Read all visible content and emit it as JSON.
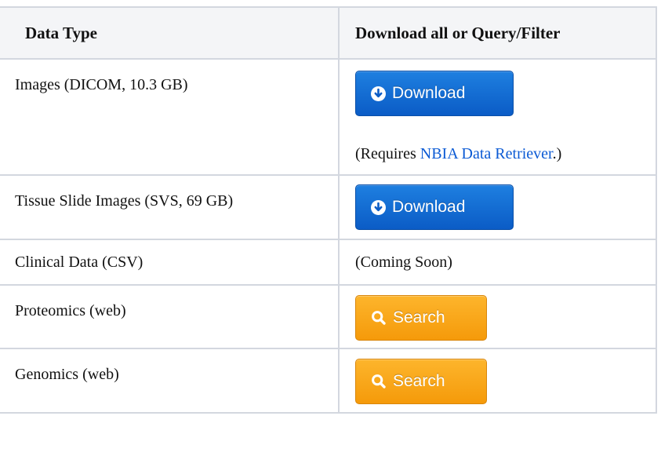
{
  "table": {
    "headers": [
      "Data Type",
      "Download all or Query/Filter"
    ],
    "rows": [
      {
        "data_type": "Images (DICOM, 10.3 GB)",
        "action_label": "Download",
        "action_kind": "download",
        "note_prefix": "(Requires ",
        "note_link": "NBIA Data Retriever",
        "note_suffix": ".)"
      },
      {
        "data_type": "Tissue Slide Images (SVS, 69 GB)",
        "action_label": "Download",
        "action_kind": "download"
      },
      {
        "data_type": "Clinical Data (CSV)",
        "action_text": "(Coming Soon)"
      },
      {
        "data_type": "Proteomics (web)",
        "action_label": "Search",
        "action_kind": "search"
      },
      {
        "data_type": "Genomics (web)",
        "action_label": "Search",
        "action_kind": "search"
      }
    ]
  },
  "colors": {
    "download_button": "#0b6ad8",
    "search_button": "#f8a91b",
    "link": "#0b5ad4",
    "border": "#d3d7df",
    "header_bg": "#f4f5f7"
  },
  "icons": {
    "download": "circle-arrow-down-icon",
    "search": "magnifier-icon"
  }
}
